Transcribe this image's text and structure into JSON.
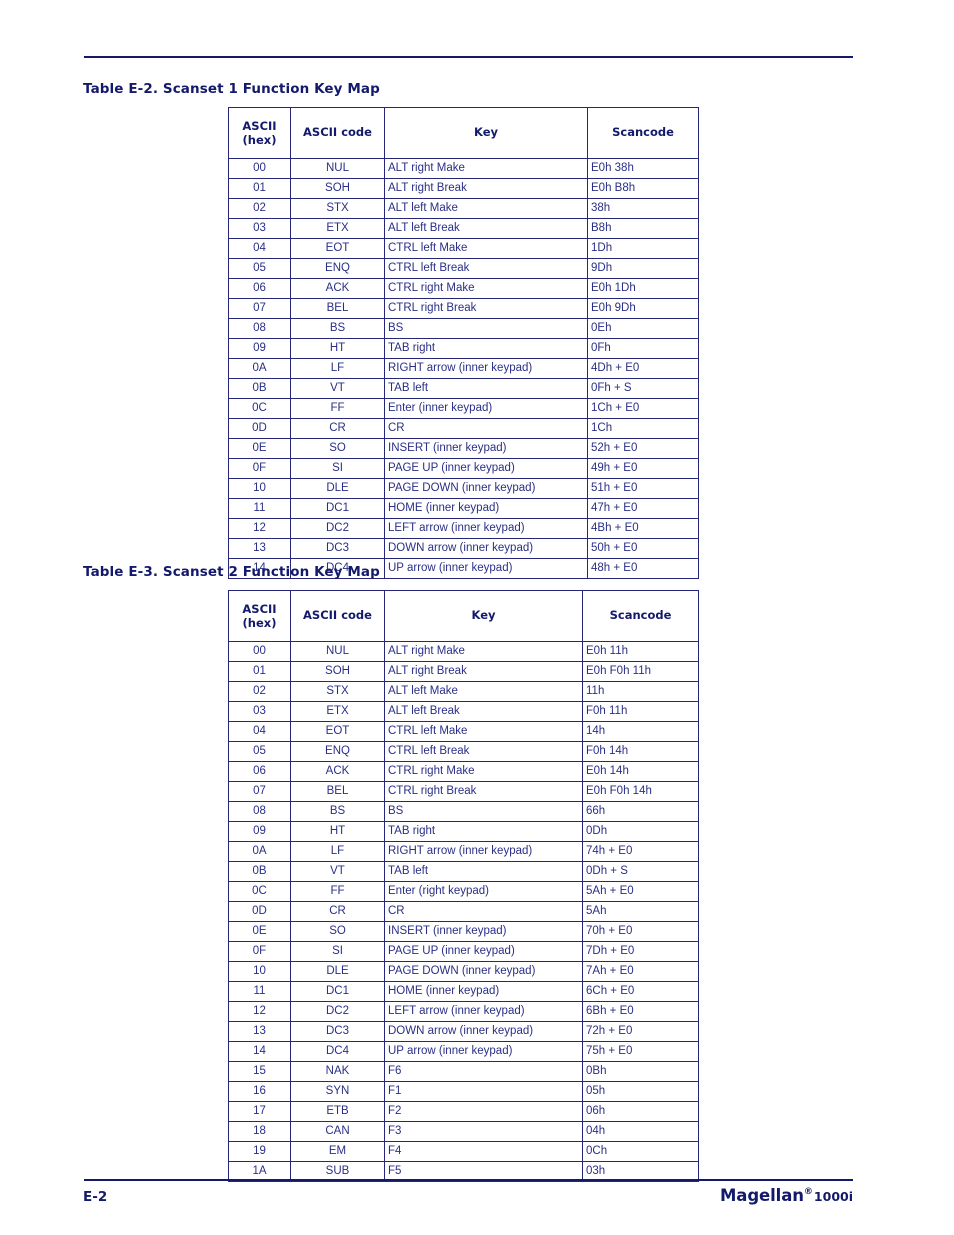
{
  "page": {
    "footer_page_number": "E-2",
    "footer_brand": "Magellan",
    "footer_registered_mark": "®",
    "footer_model": "1000i",
    "accent_color": "#141a6b",
    "table_text_color": "#2a2f86",
    "border_color": "#26277a"
  },
  "tables": [
    {
      "id": "table-e2",
      "title": "Table E-2. Scanset 1 Function Key Map",
      "columns": [
        {
          "label_line1": "ASCII",
          "label_line2": "(hex)"
        },
        {
          "label_line1": "ASCII code",
          "label_line2": ""
        },
        {
          "label_line1": "Key",
          "label_line2": ""
        },
        {
          "label_line1": "Scancode",
          "label_line2": ""
        }
      ],
      "rows": [
        {
          "hex": "00",
          "code": "NUL",
          "key": "ALT right Make",
          "scancode": "E0h 38h"
        },
        {
          "hex": "01",
          "code": "SOH",
          "key": "ALT right Break",
          "scancode": "E0h B8h"
        },
        {
          "hex": "02",
          "code": "STX",
          "key": "ALT left Make",
          "scancode": "38h"
        },
        {
          "hex": "03",
          "code": "ETX",
          "key": "ALT left Break",
          "scancode": "B8h"
        },
        {
          "hex": "04",
          "code": "EOT",
          "key": "CTRL left Make",
          "scancode": "1Dh"
        },
        {
          "hex": "05",
          "code": "ENQ",
          "key": "CTRL left Break",
          "scancode": "9Dh"
        },
        {
          "hex": "06",
          "code": "ACK",
          "key": "CTRL right Make",
          "scancode": "E0h 1Dh"
        },
        {
          "hex": "07",
          "code": "BEL",
          "key": "CTRL right Break",
          "scancode": "E0h 9Dh"
        },
        {
          "hex": "08",
          "code": "BS",
          "key": "BS",
          "scancode": "0Eh"
        },
        {
          "hex": "09",
          "code": "HT",
          "key": "TAB right",
          "scancode": "0Fh"
        },
        {
          "hex": "0A",
          "code": "LF",
          "key": "RIGHT arrow (inner keypad)",
          "scancode": "4Dh + E0"
        },
        {
          "hex": "0B",
          "code": "VT",
          "key": "TAB left",
          "scancode": "0Fh + S"
        },
        {
          "hex": "0C",
          "code": "FF",
          "key": "Enter (inner keypad)",
          "scancode": "1Ch + E0"
        },
        {
          "hex": "0D",
          "code": "CR",
          "key": "CR",
          "scancode": "1Ch"
        },
        {
          "hex": "0E",
          "code": "SO",
          "key": "INSERT (inner keypad)",
          "scancode": "52h + E0"
        },
        {
          "hex": "0F",
          "code": "SI",
          "key": "PAGE UP (inner keypad)",
          "scancode": "49h + E0"
        },
        {
          "hex": "10",
          "code": "DLE",
          "key": "PAGE DOWN (inner keypad)",
          "scancode": "51h + E0"
        },
        {
          "hex": "11",
          "code": "DC1",
          "key": "HOME (inner keypad)",
          "scancode": "47h + E0"
        },
        {
          "hex": "12",
          "code": "DC2",
          "key": "LEFT arrow (inner keypad)",
          "scancode": "4Bh + E0"
        },
        {
          "hex": "13",
          "code": "DC3",
          "key": "DOWN arrow (inner keypad)",
          "scancode": "50h + E0"
        },
        {
          "hex": "14",
          "code": "DC4",
          "key": "UP arrow (inner keypad)",
          "scancode": "48h + E0"
        }
      ]
    },
    {
      "id": "table-e3",
      "title": "Table E-3. Scanset 2 Function Key Map",
      "columns": [
        {
          "label_line1": "ASCII",
          "label_line2": "(hex)"
        },
        {
          "label_line1": "ASCII code",
          "label_line2": ""
        },
        {
          "label_line1": "Key",
          "label_line2": ""
        },
        {
          "label_line1": "Scancode",
          "label_line2": ""
        }
      ],
      "rows": [
        {
          "hex": "00",
          "code": "NUL",
          "key": "ALT right Make",
          "scancode": "E0h 11h"
        },
        {
          "hex": "01",
          "code": "SOH",
          "key": "ALT right Break",
          "scancode": "E0h F0h 11h"
        },
        {
          "hex": "02",
          "code": "STX",
          "key": "ALT left Make",
          "scancode": "11h"
        },
        {
          "hex": "03",
          "code": "ETX",
          "key": "ALT left Break",
          "scancode": "F0h 11h"
        },
        {
          "hex": "04",
          "code": "EOT",
          "key": "CTRL left Make",
          "scancode": "14h"
        },
        {
          "hex": "05",
          "code": "ENQ",
          "key": "CTRL left Break",
          "scancode": "F0h 14h"
        },
        {
          "hex": "06",
          "code": "ACK",
          "key": "CTRL right Make",
          "scancode": "E0h 14h"
        },
        {
          "hex": "07",
          "code": "BEL",
          "key": "CTRL right Break",
          "scancode": "E0h F0h 14h"
        },
        {
          "hex": "08",
          "code": "BS",
          "key": "BS",
          "scancode": "66h"
        },
        {
          "hex": "09",
          "code": "HT",
          "key": "TAB right",
          "scancode": "0Dh"
        },
        {
          "hex": "0A",
          "code": "LF",
          "key": "RIGHT arrow (inner keypad)",
          "scancode": "74h + E0"
        },
        {
          "hex": "0B",
          "code": "VT",
          "key": "TAB left",
          "scancode": "0Dh + S"
        },
        {
          "hex": "0C",
          "code": "FF",
          "key": "Enter (right keypad)",
          "scancode": "5Ah + E0"
        },
        {
          "hex": "0D",
          "code": "CR",
          "key": "CR",
          "scancode": "5Ah"
        },
        {
          "hex": "0E",
          "code": "SO",
          "key": "INSERT (inner keypad)",
          "scancode": "70h + E0"
        },
        {
          "hex": "0F",
          "code": "SI",
          "key": "PAGE UP (inner keypad)",
          "scancode": "7Dh + E0"
        },
        {
          "hex": "10",
          "code": "DLE",
          "key": "PAGE DOWN (inner keypad)",
          "scancode": "7Ah + E0"
        },
        {
          "hex": "11",
          "code": "DC1",
          "key": "HOME (inner keypad)",
          "scancode": "6Ch + E0"
        },
        {
          "hex": "12",
          "code": "DC2",
          "key": "LEFT arrow (inner keypad)",
          "scancode": "6Bh + E0"
        },
        {
          "hex": "13",
          "code": "DC3",
          "key": "DOWN arrow (inner keypad)",
          "scancode": "72h + E0"
        },
        {
          "hex": "14",
          "code": "DC4",
          "key": "UP arrow (inner keypad)",
          "scancode": "75h + E0"
        },
        {
          "hex": "15",
          "code": "NAK",
          "key": "F6",
          "scancode": "0Bh"
        },
        {
          "hex": "16",
          "code": "SYN",
          "key": "F1",
          "scancode": "05h"
        },
        {
          "hex": "17",
          "code": "ETB",
          "key": "F2",
          "scancode": "06h"
        },
        {
          "hex": "18",
          "code": "CAN",
          "key": "F3",
          "scancode": "04h"
        },
        {
          "hex": "19",
          "code": "EM",
          "key": "F4",
          "scancode": "0Ch"
        },
        {
          "hex": "1A",
          "code": "SUB",
          "key": "F5",
          "scancode": "03h"
        }
      ]
    }
  ]
}
